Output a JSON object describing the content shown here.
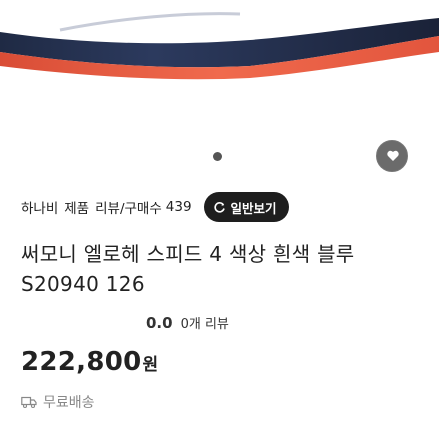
{
  "product": {
    "store_name": "하나비",
    "store_sub": "제품",
    "review_count_label": "리뷰/구매수",
    "review_count": "439",
    "view_button_label": "일반보기",
    "title": "써모니 엘로헤 스피드 4 색상 흰색 블루 S20940 126",
    "rating_value": "0.0",
    "rating_label": "0개 리뷰",
    "price": "222,800",
    "price_unit": "원",
    "shipping": "무료배송"
  },
  "colors": {
    "accent": "#1e1e1e",
    "hero_band": "#e9573f"
  }
}
